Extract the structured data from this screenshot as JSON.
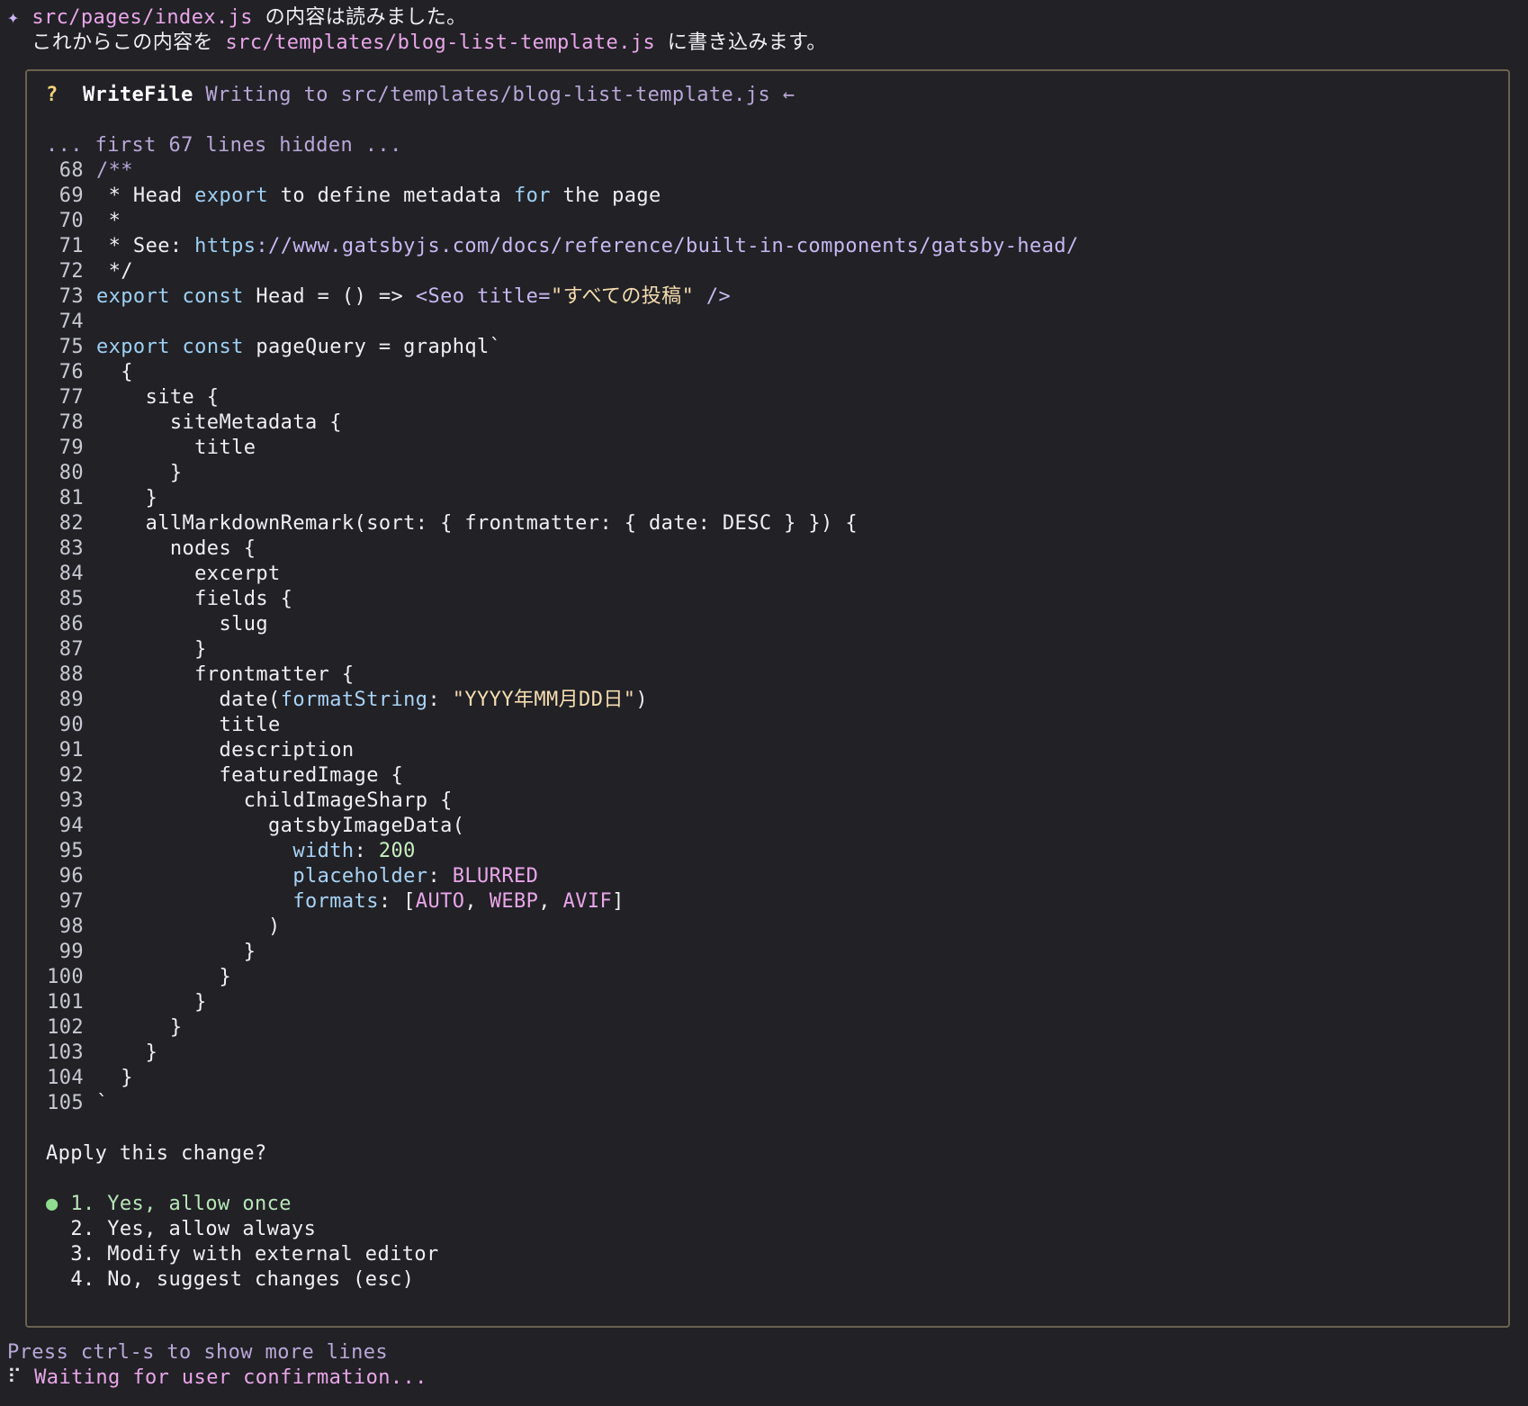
{
  "header": {
    "sparkle": "✦",
    "line1_path": "src/pages/index.js",
    "line1_text": " の内容は読みました。",
    "line2_prefix": "  これからこの内容を ",
    "line2_path": "src/templates/blog-list-template.js",
    "line2_suffix": " に書き込みます。"
  },
  "dialog": {
    "question_mark": "?",
    "tool_name": "WriteFile",
    "tool_desc": " Writing to src/templates/blog-list-template.js ←",
    "hidden_note": "... first 67 lines hidden ...",
    "code_lines": [
      {
        "n": "68",
        "segs": [
          {
            "t": "/**",
            "c": "cm"
          }
        ]
      },
      {
        "n": "69",
        "segs": [
          {
            "t": " * Head ",
            "c": ""
          },
          {
            "t": "export",
            "c": "kw"
          },
          {
            "t": " to define metadata ",
            "c": ""
          },
          {
            "t": "for",
            "c": "kw"
          },
          {
            "t": " the page",
            "c": ""
          }
        ]
      },
      {
        "n": "70",
        "segs": [
          {
            "t": " *",
            "c": ""
          }
        ]
      },
      {
        "n": "71",
        "segs": [
          {
            "t": " * See: ",
            "c": ""
          },
          {
            "t": "https",
            "c": "kw"
          },
          {
            "t": "://www.gatsbyjs.com/docs/reference/built-in-components/gatsby-head/",
            "c": "url"
          }
        ]
      },
      {
        "n": "72",
        "segs": [
          {
            "t": " */",
            "c": ""
          }
        ]
      },
      {
        "n": "73",
        "segs": [
          {
            "t": "export",
            "c": "kw"
          },
          {
            "t": " ",
            "c": ""
          },
          {
            "t": "const",
            "c": "kw"
          },
          {
            "t": " Head = () => ",
            "c": ""
          },
          {
            "t": "<Seo",
            "c": "tag"
          },
          {
            "t": " ",
            "c": ""
          },
          {
            "t": "title=",
            "c": "tag"
          },
          {
            "t": "\"すべての投稿\"",
            "c": "str"
          },
          {
            "t": " />",
            "c": "tag"
          }
        ]
      },
      {
        "n": "74",
        "segs": [
          {
            "t": "",
            "c": ""
          }
        ]
      },
      {
        "n": "75",
        "segs": [
          {
            "t": "export",
            "c": "kw"
          },
          {
            "t": " ",
            "c": ""
          },
          {
            "t": "const",
            "c": "kw"
          },
          {
            "t": " pageQuery = graphql`",
            "c": ""
          }
        ]
      },
      {
        "n": "76",
        "segs": [
          {
            "t": "  {",
            "c": ""
          }
        ]
      },
      {
        "n": "77",
        "segs": [
          {
            "t": "    site {",
            "c": ""
          }
        ]
      },
      {
        "n": "78",
        "segs": [
          {
            "t": "      siteMetadata {",
            "c": ""
          }
        ]
      },
      {
        "n": "79",
        "segs": [
          {
            "t": "        title",
            "c": ""
          }
        ]
      },
      {
        "n": "80",
        "segs": [
          {
            "t": "      }",
            "c": ""
          }
        ]
      },
      {
        "n": "81",
        "segs": [
          {
            "t": "    }",
            "c": ""
          }
        ]
      },
      {
        "n": "82",
        "segs": [
          {
            "t": "    allMarkdownRemark(sort: { frontmatter: { date: DESC } }) {",
            "c": ""
          }
        ]
      },
      {
        "n": "83",
        "segs": [
          {
            "t": "      nodes {",
            "c": ""
          }
        ]
      },
      {
        "n": "84",
        "segs": [
          {
            "t": "        excerpt",
            "c": ""
          }
        ]
      },
      {
        "n": "85",
        "segs": [
          {
            "t": "        fields {",
            "c": ""
          }
        ]
      },
      {
        "n": "86",
        "segs": [
          {
            "t": "          slug",
            "c": ""
          }
        ]
      },
      {
        "n": "87",
        "segs": [
          {
            "t": "        }",
            "c": ""
          }
        ]
      },
      {
        "n": "88",
        "segs": [
          {
            "t": "        frontmatter {",
            "c": ""
          }
        ]
      },
      {
        "n": "89",
        "segs": [
          {
            "t": "          date(",
            "c": ""
          },
          {
            "t": "formatString",
            "c": "prop"
          },
          {
            "t": ": ",
            "c": ""
          },
          {
            "t": "\"YYYY年MM月DD日\"",
            "c": "str"
          },
          {
            "t": ")",
            "c": ""
          }
        ]
      },
      {
        "n": "90",
        "segs": [
          {
            "t": "          title",
            "c": ""
          }
        ]
      },
      {
        "n": "91",
        "segs": [
          {
            "t": "          description",
            "c": ""
          }
        ]
      },
      {
        "n": "92",
        "segs": [
          {
            "t": "          featuredImage {",
            "c": ""
          }
        ]
      },
      {
        "n": "93",
        "segs": [
          {
            "t": "            childImageSharp {",
            "c": ""
          }
        ]
      },
      {
        "n": "94",
        "segs": [
          {
            "t": "              gatsbyImageData(",
            "c": ""
          }
        ]
      },
      {
        "n": "95",
        "segs": [
          {
            "t": "                ",
            "c": ""
          },
          {
            "t": "width",
            "c": "prop"
          },
          {
            "t": ": ",
            "c": ""
          },
          {
            "t": "200",
            "c": "num"
          }
        ]
      },
      {
        "n": "96",
        "segs": [
          {
            "t": "                ",
            "c": ""
          },
          {
            "t": "placeholder",
            "c": "prop"
          },
          {
            "t": ": ",
            "c": ""
          },
          {
            "t": "BLURRED",
            "c": "enum"
          }
        ]
      },
      {
        "n": "97",
        "segs": [
          {
            "t": "                ",
            "c": ""
          },
          {
            "t": "formats",
            "c": "prop"
          },
          {
            "t": ": [",
            "c": ""
          },
          {
            "t": "AUTO",
            "c": "enum"
          },
          {
            "t": ", ",
            "c": ""
          },
          {
            "t": "WEBP",
            "c": "enum"
          },
          {
            "t": ", ",
            "c": ""
          },
          {
            "t": "AVIF",
            "c": "enum"
          },
          {
            "t": "]",
            "c": ""
          }
        ]
      },
      {
        "n": "98",
        "segs": [
          {
            "t": "              )",
            "c": ""
          }
        ]
      },
      {
        "n": "99",
        "segs": [
          {
            "t": "            }",
            "c": ""
          }
        ]
      },
      {
        "n": "100",
        "segs": [
          {
            "t": "          }",
            "c": ""
          }
        ]
      },
      {
        "n": "101",
        "segs": [
          {
            "t": "        }",
            "c": ""
          }
        ]
      },
      {
        "n": "102",
        "segs": [
          {
            "t": "      }",
            "c": ""
          }
        ]
      },
      {
        "n": "103",
        "segs": [
          {
            "t": "    }",
            "c": ""
          }
        ]
      },
      {
        "n": "104",
        "segs": [
          {
            "t": "  }",
            "c": ""
          }
        ]
      },
      {
        "n": "105",
        "segs": [
          {
            "t": "`",
            "c": ""
          }
        ]
      }
    ],
    "prompt": "Apply this change?",
    "options": [
      {
        "label": "1. Yes, allow once",
        "selected": true
      },
      {
        "label": "2. Yes, allow always",
        "selected": false
      },
      {
        "label": "3. Modify with external editor",
        "selected": false
      },
      {
        "label": "4. No, suggest changes (esc)",
        "selected": false
      }
    ],
    "selected_marker": "●"
  },
  "footer": {
    "hint": "Press ctrl-s to show more lines",
    "spinner": "⠏",
    "status": " Waiting for user confirmation..."
  },
  "colors": {
    "background": "#212126",
    "border": "#6b6350",
    "path": "#e9a6e8",
    "keyword": "#9fd0f2",
    "string": "#f6ddb0",
    "selected_option": "#b8e6b8"
  }
}
